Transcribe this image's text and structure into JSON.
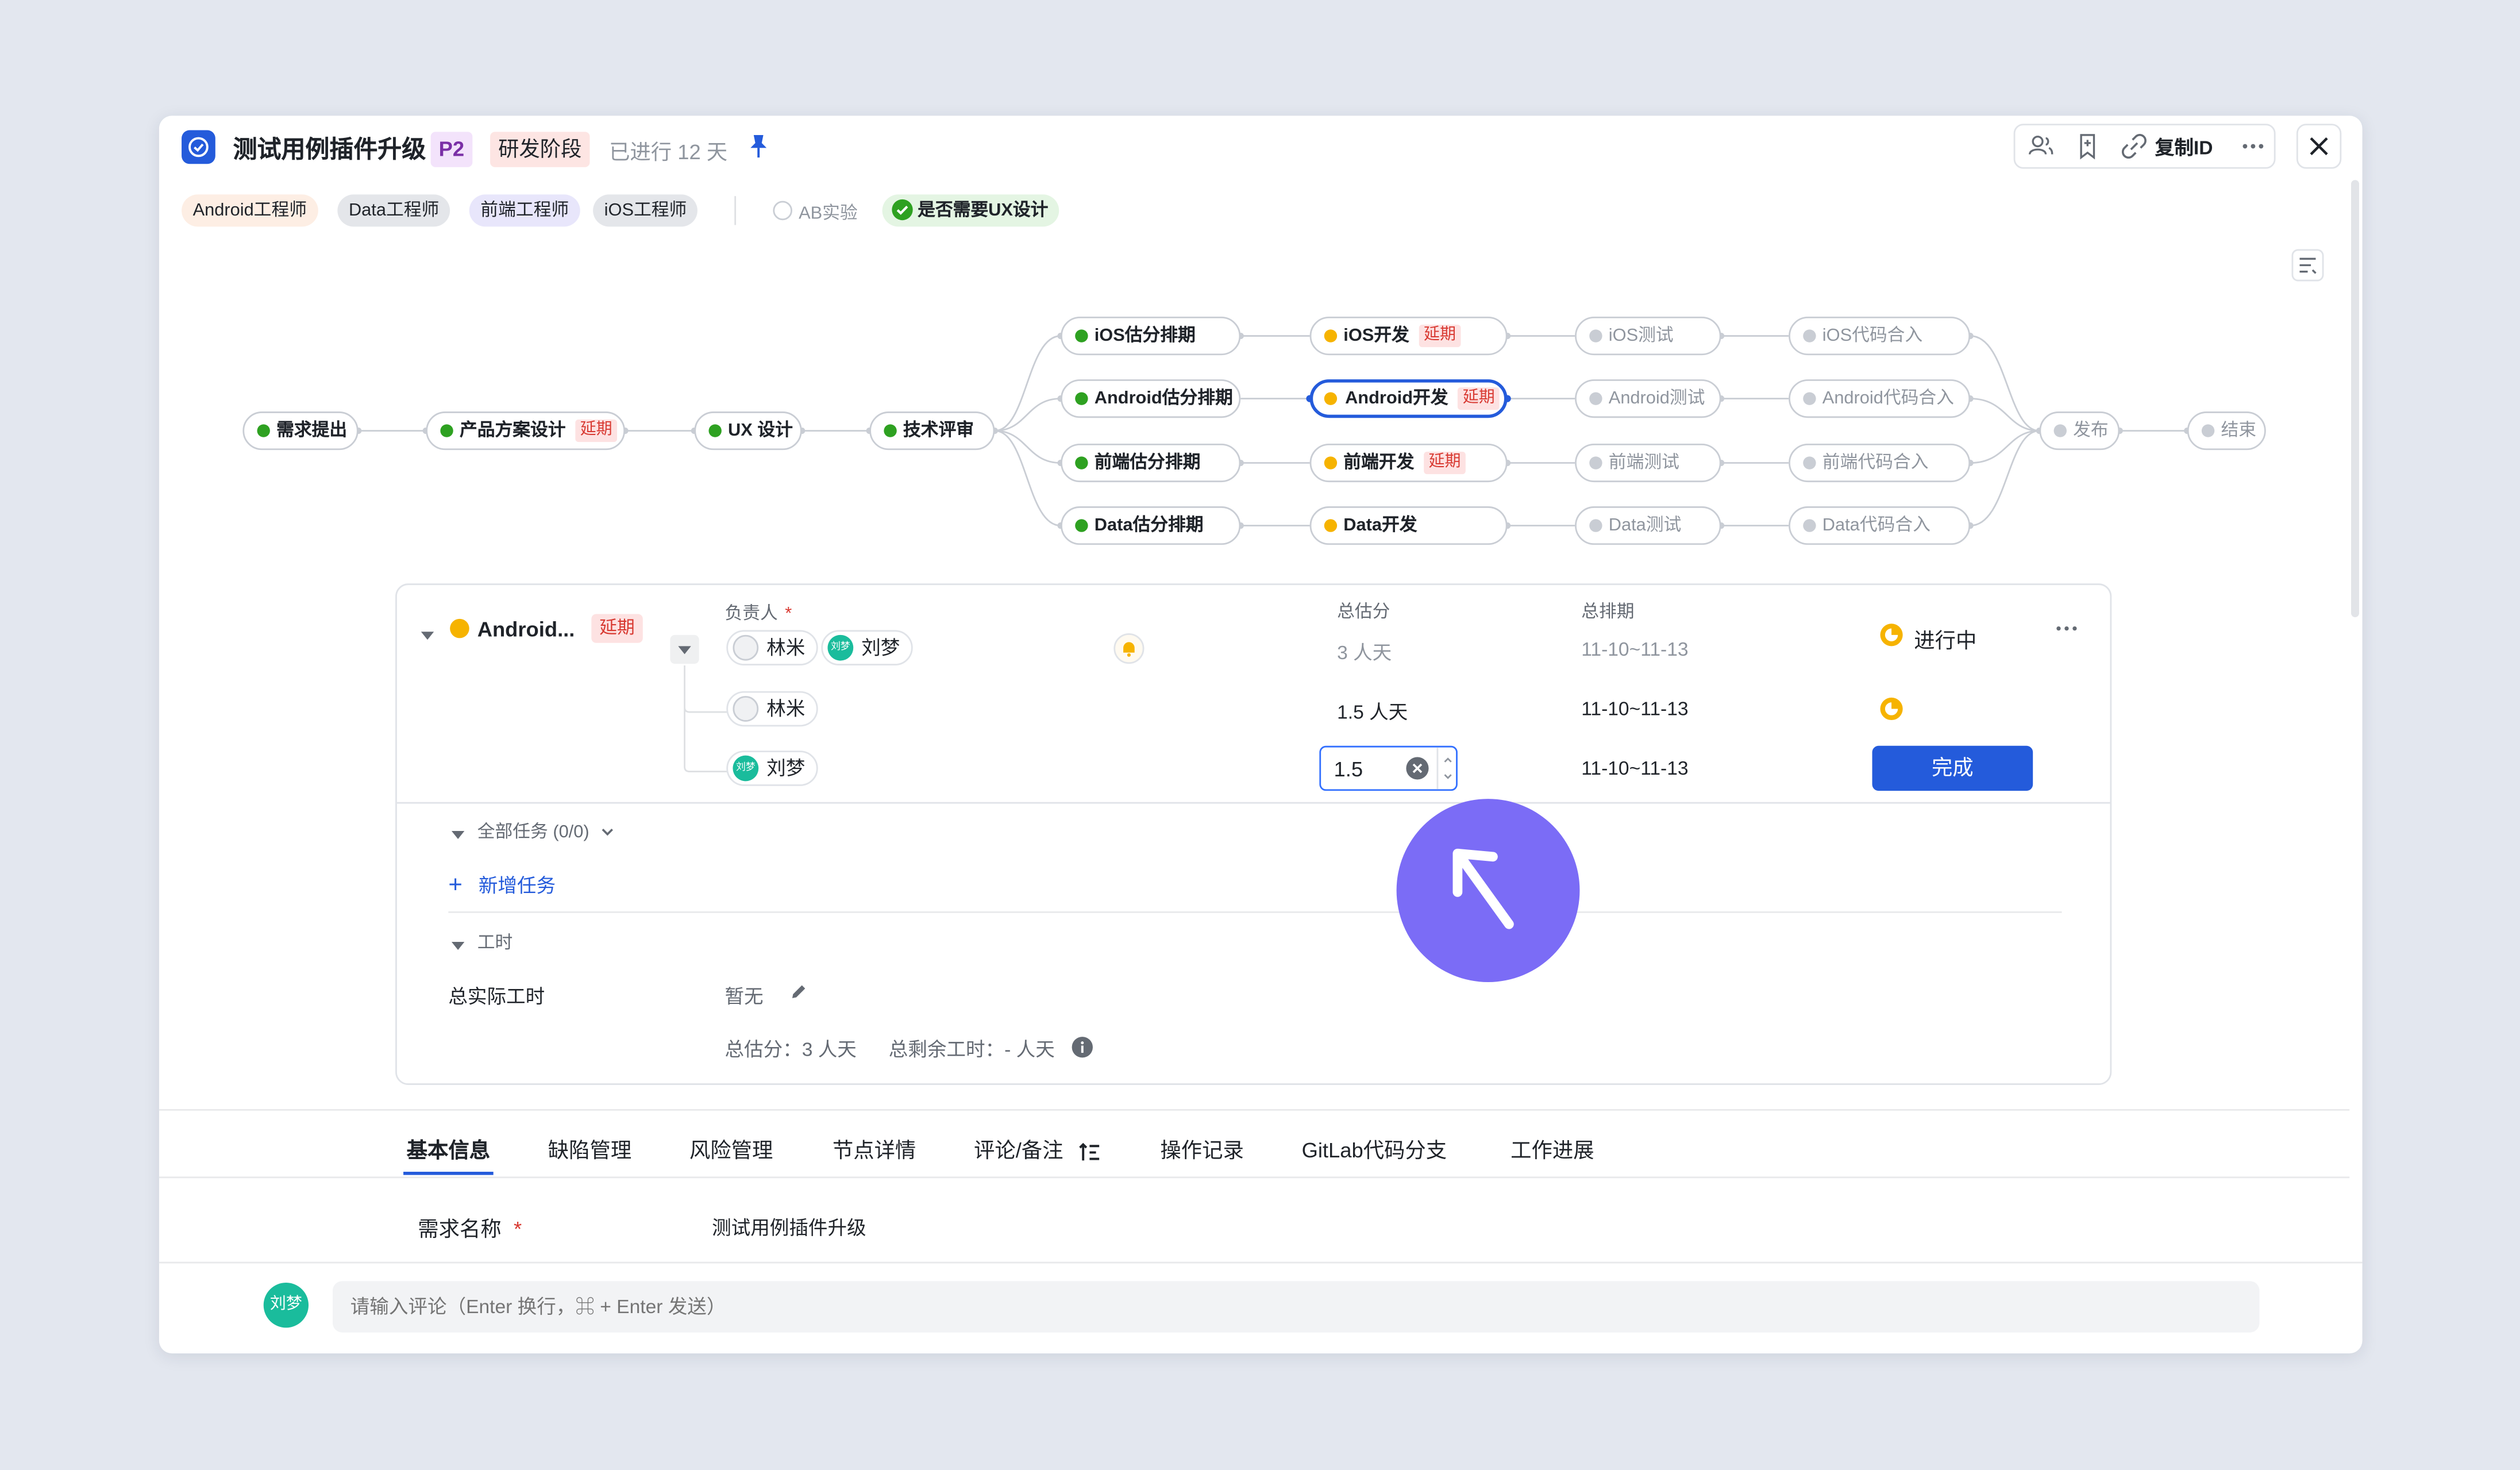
{
  "header": {
    "title": "测试用例插件升级",
    "priority": "P2",
    "stage": "研发阶段",
    "elapsed": "已进行 12 天",
    "copy_id": "复制ID"
  },
  "roles": [
    "Android工程师",
    "Data工程师",
    "前端工程师",
    "iOS工程师"
  ],
  "flags": {
    "ab": "AB实验",
    "ux": "是否需要UX设计"
  },
  "flow": {
    "delay_label": "延期",
    "main": [
      "需求提出",
      "产品方案设计",
      "UX 设计",
      "技术评审"
    ],
    "estimate": [
      "iOS估分排期",
      "Android估分排期",
      "前端估分排期",
      "Data估分排期"
    ],
    "dev": [
      "iOS开发",
      "Android开发",
      "前端开发",
      "Data开发"
    ],
    "test": [
      "iOS测试",
      "Android测试",
      "前端测试",
      "Data测试"
    ],
    "merge": [
      "iOS代码合入",
      "Android代码合入",
      "前端代码合入",
      "Data代码合入"
    ],
    "end": [
      "发布",
      "结束"
    ]
  },
  "detail": {
    "node_name": "Android...",
    "delay": "延期",
    "col_owner": "负责人",
    "required": "*",
    "col_estimate": "总估分",
    "col_schedule": "总排期",
    "rows": [
      {
        "estimate": "3 人天",
        "schedule": "11-10~11-13",
        "status": "进行中"
      },
      {
        "person": "林米",
        "estimate": "1.5 人天",
        "schedule": "11-10~11-13"
      },
      {
        "person": "刘梦",
        "estimate_input": "1.5",
        "schedule": "11-10~11-13",
        "done": "完成"
      }
    ],
    "people": {
      "a": "林米",
      "b": "刘梦",
      "b_avatar": "刘梦"
    },
    "tasks": "全部任务 (0/0)",
    "add_task": "新增任务",
    "worktime": "工时",
    "actual_label": "总实际工时",
    "actual_value": "暂无",
    "summary_estimate": "总估分：3 人天",
    "summary_remain": "总剩余工时：- 人天"
  },
  "tabs": [
    "基本信息",
    "缺陷管理",
    "风险管理",
    "节点详情",
    "评论/备注",
    "操作记录",
    "GitLab代码分支",
    "工作进展"
  ],
  "basic": {
    "name_label": "需求名称",
    "required": "*",
    "name_value": "测试用例插件升级"
  },
  "comment": {
    "avatar": "刘梦",
    "placeholder": "请输入评论（Enter 换行，⌘ + Enter 发送）"
  },
  "colors": {
    "accent": "#245bdb",
    "cursor": "#7b6cf6",
    "green": "#2ea121",
    "yellow": "#f6b300"
  }
}
